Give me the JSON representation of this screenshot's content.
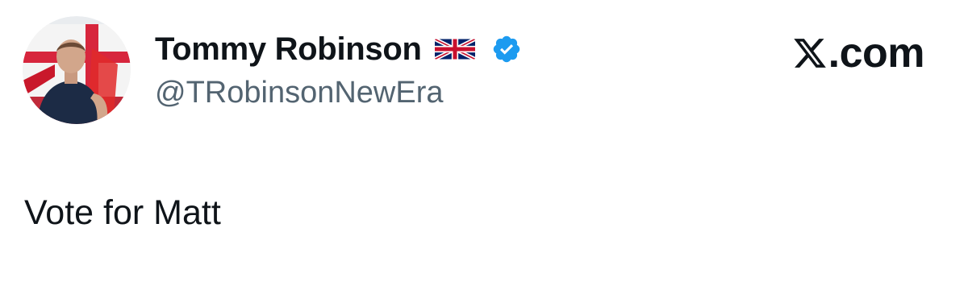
{
  "author": {
    "display_name": "Tommy Robinson",
    "handle": "@TRobinsonNewEra",
    "name_emoji": "uk-flag-icon",
    "verified": true,
    "verified_color": "#1d9bf0"
  },
  "brand": {
    "logo_text": ".com",
    "logo_icon": "x-logo-icon"
  },
  "tweet": {
    "text": "Vote for Matt"
  },
  "colors": {
    "text_primary": "#0f1419",
    "text_secondary": "#536471",
    "background": "#ffffff"
  }
}
